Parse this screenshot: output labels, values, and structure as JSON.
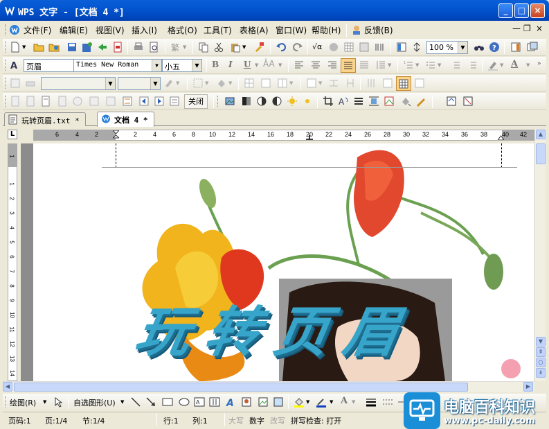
{
  "window": {
    "title": "WPS 文字 - [文档 4 *]",
    "minimize": "_",
    "maximize": "□",
    "close": "×"
  },
  "menu": {
    "items": [
      "文件(F)",
      "编辑(E)",
      "视图(V)",
      "插入(I)",
      "格式(O)",
      "工具(T)",
      "表格(A)",
      "窗口(W)",
      "帮助(H)"
    ],
    "feedback": "反馈(B)",
    "mdi_minimize": "—",
    "mdi_restore": "❐",
    "mdi_close": "×"
  },
  "standard_toolbar": {
    "zoom_value": "100 %",
    "traditional_label": "繁"
  },
  "format_toolbar": {
    "style_value": "页眉",
    "font_value": "Times New Roman",
    "size_value": "小五",
    "bold": "B",
    "italic": "I",
    "underline": "U",
    "font_color": "A"
  },
  "header_toolbar": {
    "close_label": "关闭"
  },
  "tabs": [
    {
      "label": "玩转页眉.txt *",
      "active": false
    },
    {
      "label": "文档 4 *",
      "active": true
    }
  ],
  "ruler": {
    "corner": "L",
    "h_numbers": [
      "6",
      "4",
      "2",
      "",
      "2",
      "4",
      "6",
      "8",
      "10",
      "12",
      "14",
      "16",
      "18",
      "20",
      "22",
      "24",
      "26",
      "28",
      "30",
      "32",
      "34",
      "36",
      "38",
      "40",
      "42"
    ],
    "v_numbers": [
      "1",
      "1",
      "2",
      "3",
      "4",
      "5",
      "6",
      "7",
      "8",
      "9",
      "10",
      "11",
      "12",
      "13",
      "14"
    ]
  },
  "document": {
    "wordart_text": "玩转页眉"
  },
  "drawing_toolbar": {
    "draw_label": "绘图(R)",
    "autoshape_label": "自选图形(U)"
  },
  "status": {
    "page_code": "页码:1",
    "page": "页:1/4",
    "section": "节:1/4",
    "row": "行:1",
    "col": "列:1",
    "caps": "大写",
    "num": "数字",
    "overwrite": "改写",
    "spellcheck": "拼写检查: 打开"
  },
  "watermark": {
    "title": "电脑百科知识",
    "url": "www.pc-daily.com"
  },
  "colors": {
    "title_bar": "#0356d0",
    "wordart": "#37a4c9",
    "selected_button": "#fbd38a"
  }
}
